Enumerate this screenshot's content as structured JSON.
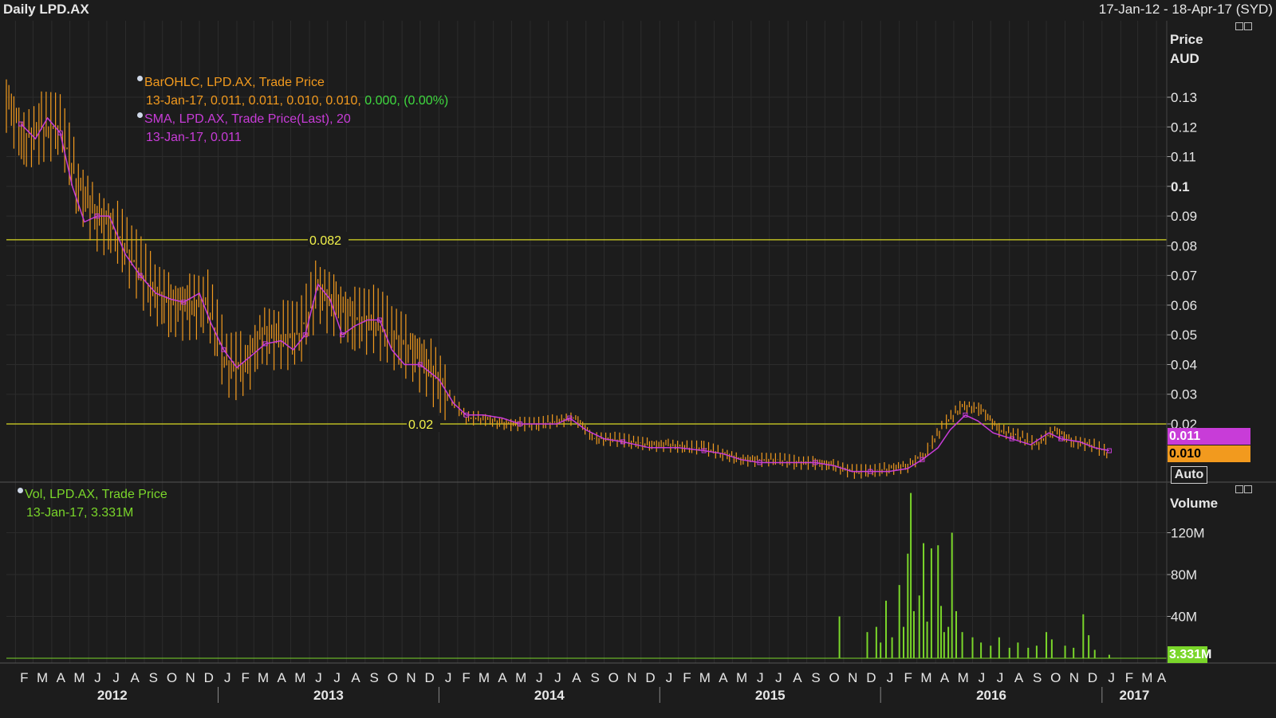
{
  "header": {
    "title": "Daily LPD.AX",
    "date_range": "17-Jan-12 - 18-Apr-17 (SYD)"
  },
  "price_axis": {
    "heading_line1": "Price",
    "heading_line2": "AUD",
    "auto_label": "Auto",
    "last_sma_tag": "0.011",
    "last_price_tag": "0.010"
  },
  "volume_axis": {
    "heading": "Volume",
    "last_volume_tag": "3.331M"
  },
  "legend_price": {
    "line1": "BarOHLC, LPD.AX, Trade Price",
    "line2_values": "13-Jan-17, 0.011, 0.011, 0.010, 0.010,",
    "line2_change": "0.000, (0.00%)",
    "line3": "SMA, LPD.AX, Trade Price(Last),  20",
    "line4": "13-Jan-17, 0.011"
  },
  "legend_volume": {
    "line1": "Vol, LPD.AX, Trade Price",
    "line2": "13-Jan-17, 3.331M"
  },
  "colors": {
    "background": "#1c1c1c",
    "ohlc": "#f29a1e",
    "sma": "#c83cd8",
    "volume": "#7ad62a",
    "level_line": "#d8d824",
    "grid": "#2c2c2c",
    "axis_text": "#e6e6e6"
  },
  "chart_data": [
    {
      "type": "bar",
      "subtype": "ohlc",
      "title": "Daily LPD.AX",
      "ylabel": "Price AUD",
      "ylim": [
        0.0,
        0.14
      ],
      "y_ticks": [
        0.02,
        0.03,
        0.04,
        0.05,
        0.06,
        0.07,
        0.08,
        0.1,
        0.11,
        0.12,
        0.13
      ],
      "y_tick_labels": [
        "0.02",
        "0.03",
        "0.04",
        "0.05",
        "0.06",
        "0.07",
        "0.08",
        "0.09",
        "0.1",
        "0.11",
        "0.12",
        "0.13"
      ],
      "y_tick_values": [
        0.02,
        0.03,
        0.04,
        0.05,
        0.06,
        0.07,
        0.08,
        0.09,
        0.1,
        0.11,
        0.12,
        0.13
      ],
      "x_month_labels": [
        "F",
        "M",
        "A",
        "M",
        "J",
        "J",
        "A",
        "S",
        "O",
        "N",
        "D",
        "J",
        "F",
        "M",
        "A",
        "M",
        "J",
        "J",
        "A",
        "S",
        "O",
        "N",
        "D",
        "J",
        "F",
        "M",
        "A",
        "M",
        "J",
        "J",
        "A",
        "S",
        "O",
        "N",
        "D",
        "J",
        "F",
        "M",
        "A",
        "M",
        "J",
        "J",
        "A",
        "S",
        "O",
        "N",
        "D",
        "J",
        "F",
        "M",
        "A",
        "M",
        "J",
        "J",
        "A",
        "S",
        "O",
        "N",
        "D",
        "J",
        "F",
        "M",
        "A"
      ],
      "x_year_labels": [
        "2012",
        "2013",
        "2014",
        "2015",
        "2016",
        "2017"
      ],
      "level_lines": [
        {
          "value": 0.082,
          "label": "0.082"
        },
        {
          "value": 0.02,
          "label": "0.02"
        }
      ],
      "series": [
        {
          "name": "BarOHLC, LPD.AX, Trade Price",
          "kind": "price_close",
          "points": [
            [
              "2012-01-17",
              0.13
            ],
            [
              "2012-02-15",
              0.115
            ],
            [
              "2012-03-15",
              0.12
            ],
            [
              "2012-04-15",
              0.12
            ],
            [
              "2012-05-15",
              0.1
            ],
            [
              "2012-06-15",
              0.09
            ],
            [
              "2012-07-15",
              0.085
            ],
            [
              "2012-08-15",
              0.075
            ],
            [
              "2012-09-15",
              0.065
            ],
            [
              "2012-10-15",
              0.06
            ],
            [
              "2012-11-15",
              0.06
            ],
            [
              "2012-12-15",
              0.06
            ],
            [
              "2013-01-15",
              0.04
            ],
            [
              "2013-02-15",
              0.04
            ],
            [
              "2013-03-15",
              0.05
            ],
            [
              "2013-04-15",
              0.05
            ],
            [
              "2013-05-15",
              0.05
            ],
            [
              "2013-06-15",
              0.065
            ],
            [
              "2013-07-15",
              0.06
            ],
            [
              "2013-08-15",
              0.055
            ],
            [
              "2013-09-15",
              0.055
            ],
            [
              "2013-10-15",
              0.05
            ],
            [
              "2013-11-15",
              0.045
            ],
            [
              "2013-12-15",
              0.04
            ],
            [
              "2014-01-15",
              0.03
            ],
            [
              "2014-02-15",
              0.022
            ],
            [
              "2014-03-15",
              0.022
            ],
            [
              "2014-04-15",
              0.02
            ],
            [
              "2014-05-15",
              0.02
            ],
            [
              "2014-06-15",
              0.02
            ],
            [
              "2014-07-15",
              0.021
            ],
            [
              "2014-08-15",
              0.022
            ],
            [
              "2014-09-15",
              0.015
            ],
            [
              "2014-10-15",
              0.015
            ],
            [
              "2014-11-15",
              0.014
            ],
            [
              "2014-12-15",
              0.013
            ],
            [
              "2015-01-15",
              0.013
            ],
            [
              "2015-02-15",
              0.012
            ],
            [
              "2015-03-15",
              0.012
            ],
            [
              "2015-04-15",
              0.01
            ],
            [
              "2015-05-15",
              0.008
            ],
            [
              "2015-06-15",
              0.008
            ],
            [
              "2015-07-15",
              0.008
            ],
            [
              "2015-08-15",
              0.007
            ],
            [
              "2015-09-15",
              0.007
            ],
            [
              "2015-10-15",
              0.006
            ],
            [
              "2015-11-15",
              0.004
            ],
            [
              "2015-12-15",
              0.004
            ],
            [
              "2016-01-15",
              0.005
            ],
            [
              "2016-02-15",
              0.006
            ],
            [
              "2016-03-15",
              0.01
            ],
            [
              "2016-04-15",
              0.02
            ],
            [
              "2016-05-15",
              0.026
            ],
            [
              "2016-06-15",
              0.025
            ],
            [
              "2016-07-15",
              0.018
            ],
            [
              "2016-08-15",
              0.016
            ],
            [
              "2016-09-15",
              0.013
            ],
            [
              "2016-10-15",
              0.018
            ],
            [
              "2016-11-15",
              0.014
            ],
            [
              "2016-12-15",
              0.013
            ],
            [
              "2017-01-13",
              0.01
            ]
          ]
        },
        {
          "name": "SMA, LPD.AX, Trade Price(Last),  20",
          "kind": "line",
          "points": [
            [
              "2012-02-10",
              0.121
            ],
            [
              "2012-03-05",
              0.116
            ],
            [
              "2012-03-25",
              0.123
            ],
            [
              "2012-04-15",
              0.118
            ],
            [
              "2012-05-05",
              0.1
            ],
            [
              "2012-05-25",
              0.088
            ],
            [
              "2012-06-15",
              0.09
            ],
            [
              "2012-07-05",
              0.09
            ],
            [
              "2012-08-01",
              0.077
            ],
            [
              "2012-08-25",
              0.07
            ],
            [
              "2012-09-20",
              0.064
            ],
            [
              "2012-10-15",
              0.062
            ],
            [
              "2012-11-05",
              0.061
            ],
            [
              "2012-12-01",
              0.064
            ],
            [
              "2012-12-20",
              0.054
            ],
            [
              "2013-01-10",
              0.045
            ],
            [
              "2013-02-01",
              0.039
            ],
            [
              "2013-02-25",
              0.043
            ],
            [
              "2013-03-20",
              0.047
            ],
            [
              "2013-04-15",
              0.048
            ],
            [
              "2013-05-05",
              0.045
            ],
            [
              "2013-05-25",
              0.05
            ],
            [
              "2013-06-15",
              0.067
            ],
            [
              "2013-07-05",
              0.062
            ],
            [
              "2013-07-25",
              0.05
            ],
            [
              "2013-08-15",
              0.053
            ],
            [
              "2013-09-05",
              0.055
            ],
            [
              "2013-09-25",
              0.055
            ],
            [
              "2013-10-15",
              0.045
            ],
            [
              "2013-11-05",
              0.04
            ],
            [
              "2013-12-01",
              0.04
            ],
            [
              "2014-01-01",
              0.035
            ],
            [
              "2014-01-25",
              0.027
            ],
            [
              "2014-02-15",
              0.023
            ],
            [
              "2014-03-15",
              0.023
            ],
            [
              "2014-04-15",
              0.022
            ],
            [
              "2014-05-15",
              0.02
            ],
            [
              "2014-06-15",
              0.02
            ],
            [
              "2014-07-15",
              0.02
            ],
            [
              "2014-08-05",
              0.022
            ],
            [
              "2014-09-01",
              0.018
            ],
            [
              "2014-10-01",
              0.015
            ],
            [
              "2014-11-01",
              0.014
            ],
            [
              "2014-12-15",
              0.012
            ],
            [
              "2015-02-01",
              0.012
            ],
            [
              "2015-03-15",
              0.011
            ],
            [
              "2015-04-15",
              0.01
            ],
            [
              "2015-05-15",
              0.008
            ],
            [
              "2015-06-15",
              0.007
            ],
            [
              "2015-07-15",
              0.007
            ],
            [
              "2015-08-15",
              0.007
            ],
            [
              "2015-09-15",
              0.007
            ],
            [
              "2015-10-15",
              0.006
            ],
            [
              "2015-11-15",
              0.004
            ],
            [
              "2015-12-15",
              0.004
            ],
            [
              "2016-01-15",
              0.004
            ],
            [
              "2016-02-15",
              0.005
            ],
            [
              "2016-03-10",
              0.008
            ],
            [
              "2016-04-05",
              0.012
            ],
            [
              "2016-04-25",
              0.018
            ],
            [
              "2016-05-20",
              0.023
            ],
            [
              "2016-06-10",
              0.021
            ],
            [
              "2016-07-05",
              0.017
            ],
            [
              "2016-08-05",
              0.015
            ],
            [
              "2016-09-05",
              0.013
            ],
            [
              "2016-10-05",
              0.017
            ],
            [
              "2016-10-25",
              0.015
            ],
            [
              "2016-11-25",
              0.014
            ],
            [
              "2016-12-20",
              0.012
            ],
            [
              "2017-01-13",
              0.011
            ]
          ]
        }
      ]
    },
    {
      "type": "bar",
      "subtype": "volume",
      "ylabel": "Volume",
      "ylim": [
        0,
        160000000
      ],
      "y_ticks": [
        40000000,
        80000000,
        120000000
      ],
      "y_tick_labels": [
        "40M",
        "80M",
        "120M"
      ],
      "series": [
        {
          "name": "Vol, LPD.AX, Trade Price",
          "points": [
            [
              "2015-10-25",
              40000000
            ],
            [
              "2015-12-10",
              25000000
            ],
            [
              "2015-12-25",
              30000000
            ],
            [
              "2016-01-01",
              15000000
            ],
            [
              "2016-01-10",
              55000000
            ],
            [
              "2016-01-20",
              20000000
            ],
            [
              "2016-02-01",
              70000000
            ],
            [
              "2016-02-08",
              30000000
            ],
            [
              "2016-02-15",
              100000000
            ],
            [
              "2016-02-20",
              158000000
            ],
            [
              "2016-02-25",
              45000000
            ],
            [
              "2016-03-05",
              60000000
            ],
            [
              "2016-03-12",
              110000000
            ],
            [
              "2016-03-18",
              35000000
            ],
            [
              "2016-03-25",
              105000000
            ],
            [
              "2016-04-05",
              108000000
            ],
            [
              "2016-04-10",
              50000000
            ],
            [
              "2016-04-15",
              25000000
            ],
            [
              "2016-04-22",
              30000000
            ],
            [
              "2016-04-28",
              120000000
            ],
            [
              "2016-05-05",
              45000000
            ],
            [
              "2016-05-15",
              25000000
            ],
            [
              "2016-06-01",
              20000000
            ],
            [
              "2016-06-15",
              15000000
            ],
            [
              "2016-07-01",
              12000000
            ],
            [
              "2016-07-15",
              20000000
            ],
            [
              "2016-08-01",
              10000000
            ],
            [
              "2016-08-15",
              15000000
            ],
            [
              "2016-09-01",
              10000000
            ],
            [
              "2016-09-15",
              12000000
            ],
            [
              "2016-10-01",
              25000000
            ],
            [
              "2016-10-10",
              18000000
            ],
            [
              "2016-11-01",
              12000000
            ],
            [
              "2016-11-15",
              10000000
            ],
            [
              "2016-12-01",
              42000000
            ],
            [
              "2016-12-10",
              22000000
            ],
            [
              "2016-12-20",
              8000000
            ],
            [
              "2017-01-13",
              3331000
            ]
          ]
        }
      ]
    }
  ]
}
